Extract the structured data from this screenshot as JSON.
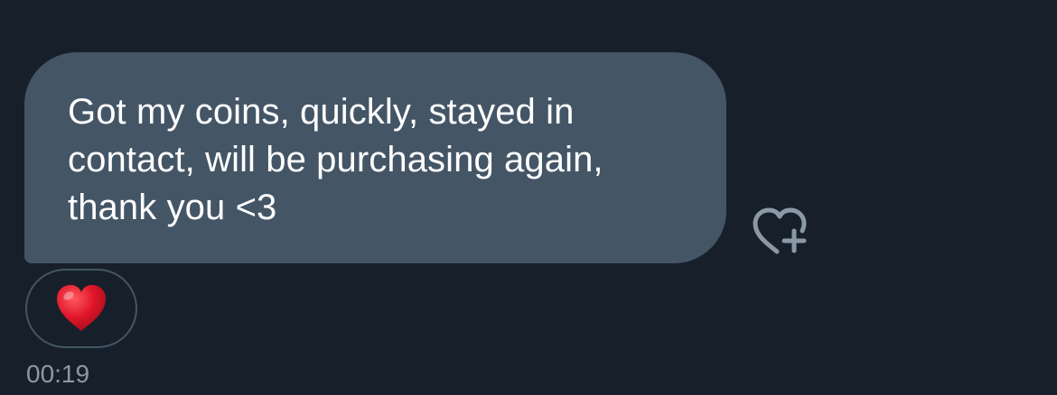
{
  "message": {
    "text": "Got my coins, quickly, stayed in\ncontact, will be purchasing again,\nthank you <3",
    "timestamp": "00:19"
  },
  "reactions": [
    {
      "emoji": "red-heart-icon",
      "count": 1
    }
  ],
  "icons": {
    "add_reaction": "heart-plus-icon"
  },
  "colors": {
    "background": "#17202a",
    "bubble": "#445566",
    "text": "#ffffff",
    "muted": "#8b98a5",
    "heart": "#e0152a"
  }
}
